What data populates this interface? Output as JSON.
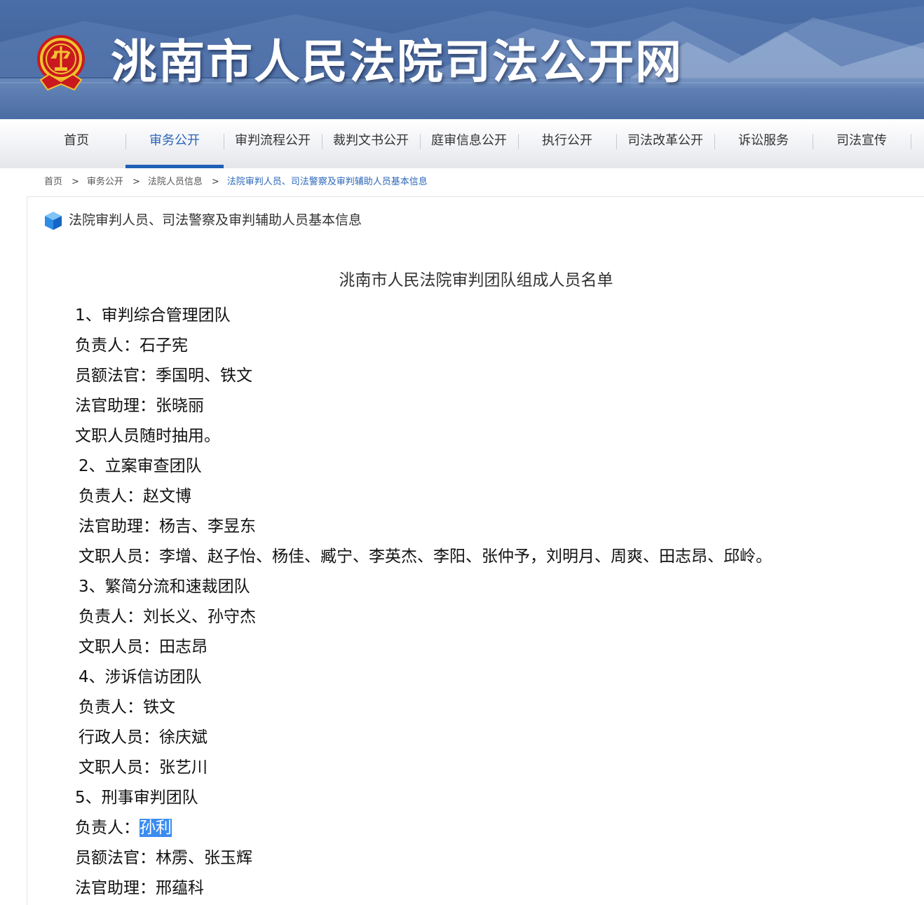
{
  "header": {
    "site_title": "洮南市人民法院司法公开网",
    "emblem": "court-emblem"
  },
  "nav": {
    "items": [
      "首页",
      "审务公开",
      "审判流程公开",
      "裁判文书公开",
      "庭审信息公开",
      "执行公开",
      "司法改革公开",
      "诉讼服务",
      "司法宣传"
    ],
    "active_index": 1,
    "accent_color": "#1f5fb5"
  },
  "breadcrumb": {
    "items": [
      "首页",
      "审务公开",
      "法院人员信息",
      "法院审判人员、司法警察及审判辅助人员基本信息"
    ],
    "separator": ">"
  },
  "panel": {
    "title": "法院审判人员、司法警察及审判辅助人员基本信息",
    "icon": "cube-icon"
  },
  "document": {
    "title": "洮南市人民法院审判团队组成人员名单",
    "lines": [
      "1、审判综合管理团队",
      "负责人：石子宪",
      "员额法官：季国明、铁文",
      "法官助理：张晓丽",
      "文职人员随时抽用。",
      "2、立案审查团队",
      "负责人：赵文博",
      "法官助理：杨吉、李昱东",
      "文职人员：李增、赵子怡、杨佳、臧宁、李英杰、李阳、张仲予，刘明月、周爽、田志昂、邱岭。",
      "3、繁简分流和速裁团队",
      "负责人：刘长义、孙守杰",
      "文职人员：田志昂",
      "4、涉诉信访团队",
      "负责人：铁文",
      "行政人员：徐庆斌",
      "文职人员：张艺川",
      "5、刑事审判团队",
      "负责人：",
      "员额法官：林雳、张玉辉",
      "法官助理：邢蕴科"
    ],
    "selected_text": "孙利"
  }
}
